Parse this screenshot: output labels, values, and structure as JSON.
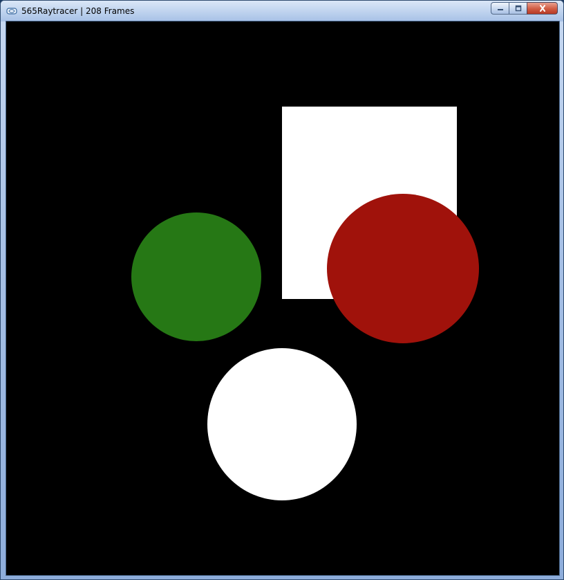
{
  "window": {
    "title": "565Raytracer | 208 Frames",
    "app_icon": "app-window-icon",
    "controls": {
      "minimize_icon": "minimize-icon",
      "maximize_icon": "maximize-icon",
      "close_icon": "close-icon"
    }
  },
  "scene": {
    "background_color": "#000000",
    "objects": [
      {
        "name": "white-rectangle",
        "shape": "rectangle",
        "color": "#ffffff"
      },
      {
        "name": "green-sphere",
        "shape": "circle",
        "color": "#267815"
      },
      {
        "name": "red-sphere",
        "shape": "circle",
        "color": "#a0120b"
      },
      {
        "name": "white-sphere",
        "shape": "circle",
        "color": "#ffffff"
      }
    ]
  }
}
